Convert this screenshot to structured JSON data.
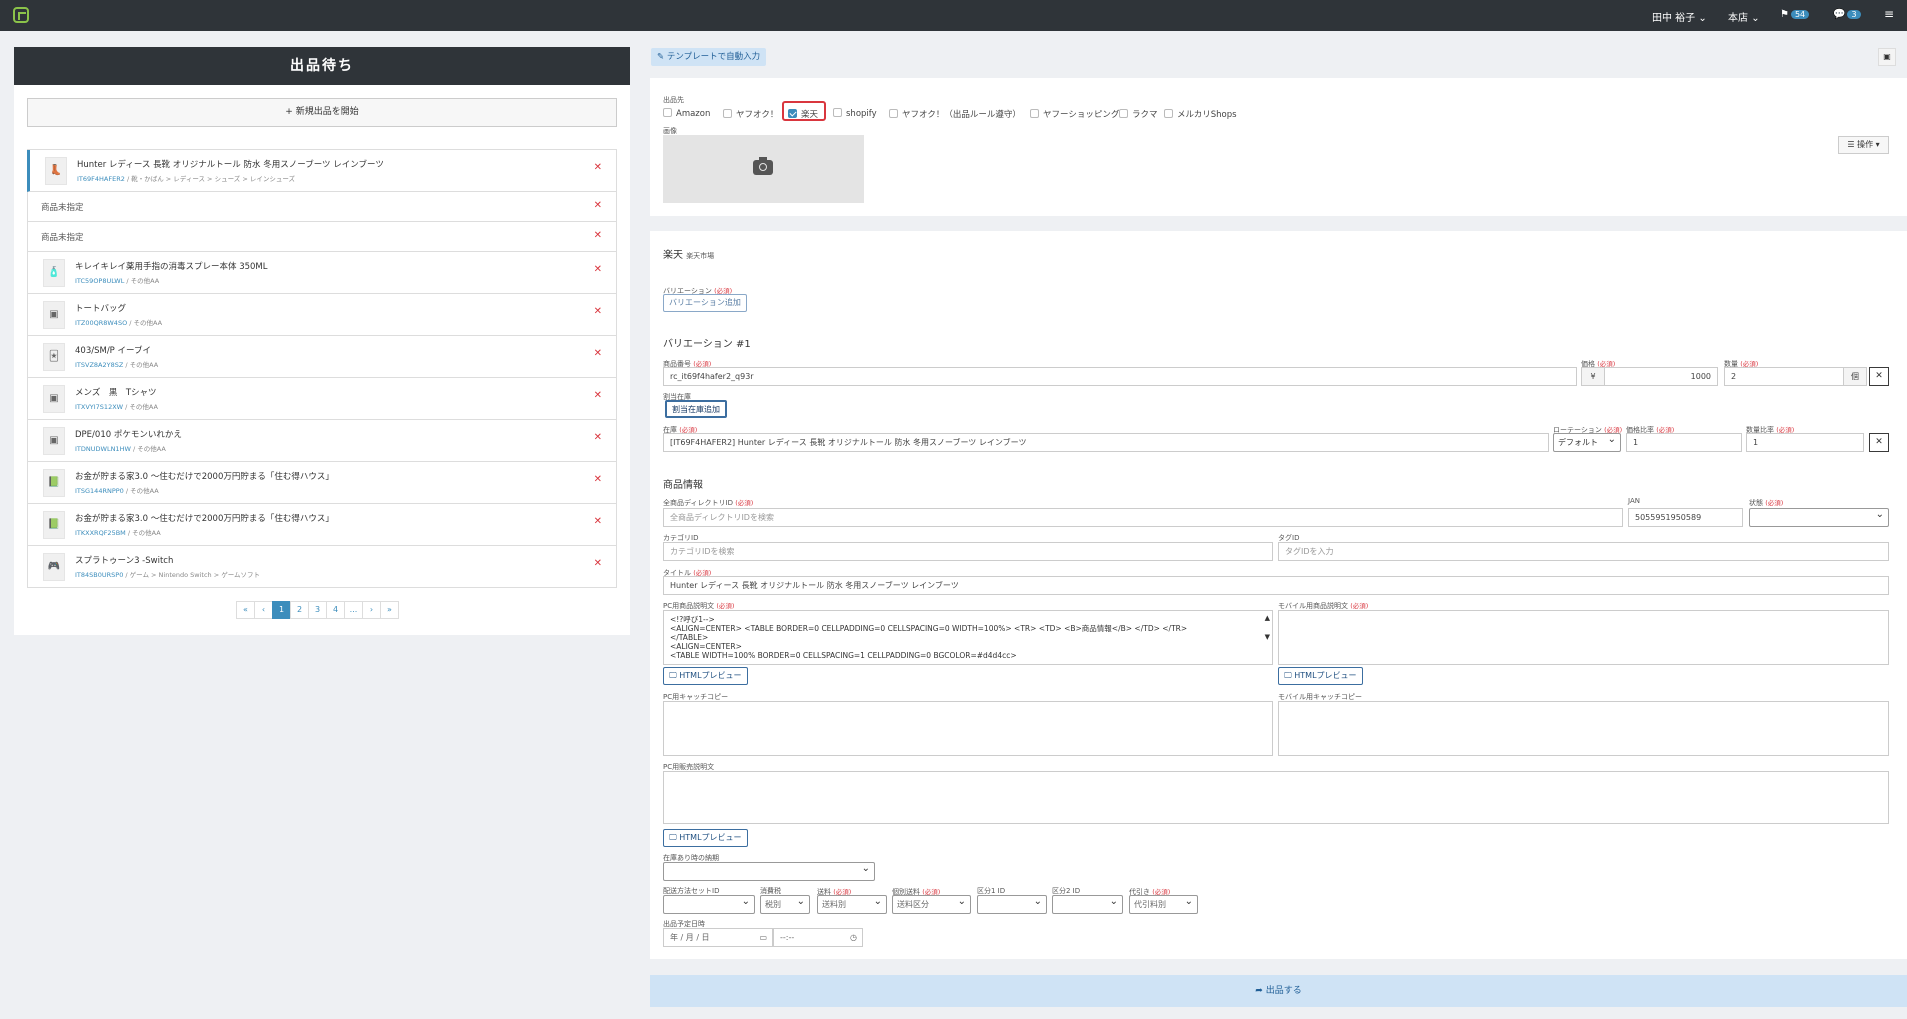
{
  "topbar": {
    "user": "田中 裕子",
    "store": "本店",
    "flag_count": "54",
    "chat_count": "3"
  },
  "left": {
    "title": "出品待ち",
    "new_button": "新規出品を開始",
    "items": [
      {
        "title": "Hunter レディース 長靴 オリジナルトール 防水 冬用スノーブーツ レインブーツ",
        "id": "IT69F4HAFER2",
        "path": " / 靴・かばん > レディース > シューズ > レインシューズ",
        "icon": "boot-icon"
      },
      {
        "plain": "商品未指定"
      },
      {
        "plain": "商品未指定"
      },
      {
        "title": "キレイキレイ薬用手指の消毒スプレー本体 350ML",
        "id": "ITC59OP8ULWL",
        "path": " / その他AA",
        "icon": "spray-bottle-icon"
      },
      {
        "title": "トートバッグ",
        "id": "ITZ00QR8W4SO",
        "path": " / その他AA",
        "icon": "image-placeholder-icon"
      },
      {
        "title": "403/SM/P イーブイ",
        "id": "ITSVZ8A2Y8SZ",
        "path": " / その他AA",
        "icon": "card-icon"
      },
      {
        "title": "メンズ　黒　Tシャツ",
        "id": "ITXVYI7S12XW",
        "path": " / その他AA",
        "icon": "image-placeholder-icon"
      },
      {
        "title": "DPE/010 ポケモンいれかえ",
        "id": "ITDNUDWLN1HW",
        "path": " / その他AA",
        "icon": "image-placeholder-icon"
      },
      {
        "title": "お金が貯まる家3.0 ～住むだけで2000万円貯まる「住む得ハウス」",
        "id": "ITSG144RNPP0",
        "path": " / その他AA",
        "icon": "book-icon"
      },
      {
        "title": "お金が貯まる家3.0 ～住むだけで2000万円貯まる「住む得ハウス」",
        "id": "ITKXXRQF25BM",
        "path": " / その他AA",
        "icon": "book-icon"
      },
      {
        "title": "スプラトゥーン3 -Switch",
        "id": "IT84SB0URSP0",
        "path": " / ゲーム > Nintendo Switch > ゲームソフト",
        "icon": "game-icon"
      }
    ],
    "pager": [
      "«",
      "‹",
      "1",
      "2",
      "3",
      "4",
      "...",
      "›",
      "»"
    ]
  },
  "template_button": "テンプレートで自動入力",
  "channels": {
    "label": "出品先",
    "items": [
      "Amazon",
      "ヤフオク！",
      "楽天",
      "shopify",
      "ヤフオク！（出品ルール遵守）",
      "ヤフーショッピング",
      "ラクマ",
      "メルカリShops"
    ],
    "checked": "楽天"
  },
  "image_label": "画像",
  "ops_button": "操作",
  "rakuten": {
    "title": "楽天",
    "subtitle": "楽天市場",
    "variation_label": "バリエーション",
    "req": "(必須)",
    "add_variation": "バリエーション追加",
    "variation_heading": "バリエーション #1",
    "sku_label": "商品番号",
    "sku_value": "rc_it69f4hafer2_q93r",
    "price_label": "価格",
    "currency": "¥",
    "price_value": "1000",
    "qty_label": "数量",
    "qty_value": "2",
    "unit": "個",
    "alloc_label": "割当在庫",
    "alloc_button": "割当在庫追加",
    "stock_label": "在庫",
    "stock_value": "[IT69F4HAFER2] Hunter レディース 長靴 オリジナルトール 防水 冬用スノーブーツ レインブーツ",
    "rotation_label": "ローテーション",
    "rotation_value": "デフォルト",
    "price_ratio_label": "価格比率",
    "price_ratio_value": "1",
    "qty_ratio_label": "数量比率",
    "qty_ratio_value": "1",
    "product_heading": "商品情報",
    "dir_label": "全商品ディレクトリID",
    "dir_placeholder": "全商品ディレクトリIDを検索",
    "jan_label": "JAN",
    "jan_value": "5055951950589",
    "cond_label": "状態",
    "cat_label": "カテゴリID",
    "cat_placeholder": "カテゴリIDを検索",
    "tag_label": "タグID",
    "tag_placeholder": "タグIDを入力",
    "title_label": "タイトル",
    "title_value": "Hunter レディース 長靴 オリジナルトール 防水 冬用スノーブーツ レインブーツ",
    "pc_desc_label": "PC用商品説明文",
    "pc_desc_lines": [
      "<!?呼び1-->",
      "<ALIGN=CENTER> <TABLE BORDER=0 CELLPADDING=0 CELLSPACING=0 WIDTH=100%> <TR> <TD> <B>商品情報</B> </TD> </TR>",
      "</TABLE>",
      "<ALIGN=CENTER>",
      "<TABLE WIDTH=100% BORDER=0 CELLSPACING=1 CELLPADDING=0 BGCOLOR=#d4d4cc>"
    ],
    "mobile_desc_label": "モバイル用商品説明文",
    "html_preview": "HTMLプレビュー",
    "pc_catch_label": "PC用キャッチコピー",
    "mobile_catch_label": "モバイル用キャッチコピー",
    "pc_sales_label": "PC用販売説明文",
    "stock_period_label": "在庫あり時の納期",
    "ship_set_label": "配送方法セットID",
    "tax_label": "消費税",
    "tax_value": "税別",
    "postage_label": "送料",
    "postage_value": "送料別",
    "individual_label": "個別送料",
    "individual_value": "送料区分",
    "k1_label": "区分1 ID",
    "k2_label": "区分2 ID",
    "cod_label": "代引き",
    "cod_value": "代引料別",
    "schedule_label": "出品予定日時",
    "date_placeholder": "年 / 月 / 日",
    "time_placeholder": "--:--"
  },
  "submit": "出品する"
}
